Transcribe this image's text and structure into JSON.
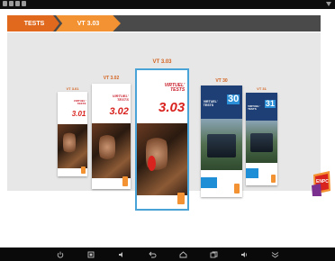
{
  "breadcrumb": {
    "root": "TESTS",
    "current": "VT 3.03"
  },
  "books": [
    {
      "id": "vt301",
      "label": "VT 3.01",
      "title": "VIRTUEL' TESTS",
      "version": "3.01"
    },
    {
      "id": "vt302",
      "label": "VT 3.02",
      "title": "VIRTUEL' TESTS",
      "version": "3.02"
    },
    {
      "id": "vt303",
      "label": "VT 3.03",
      "title": "VIRTUEL' TESTS",
      "version": "3.03"
    },
    {
      "id": "vt30",
      "label": "VT 30",
      "title": "VIRTUEL' TESTS",
      "version": "30"
    },
    {
      "id": "vt31",
      "label": "VT 31",
      "title": "VIRTUEL' TESTS",
      "version": "31"
    }
  ],
  "logo": {
    "text": "ENPC"
  },
  "navbar_icons": [
    "power-icon",
    "screenshot-icon",
    "volume-down-icon",
    "back-icon",
    "home-icon",
    "recent-apps-icon",
    "volume-up-icon",
    "collapse-icon"
  ],
  "colors": {
    "crumb_root": "#e0691d",
    "crumb_current": "#f39232",
    "label": "#d4621e",
    "selection": "#4aa3d6"
  }
}
